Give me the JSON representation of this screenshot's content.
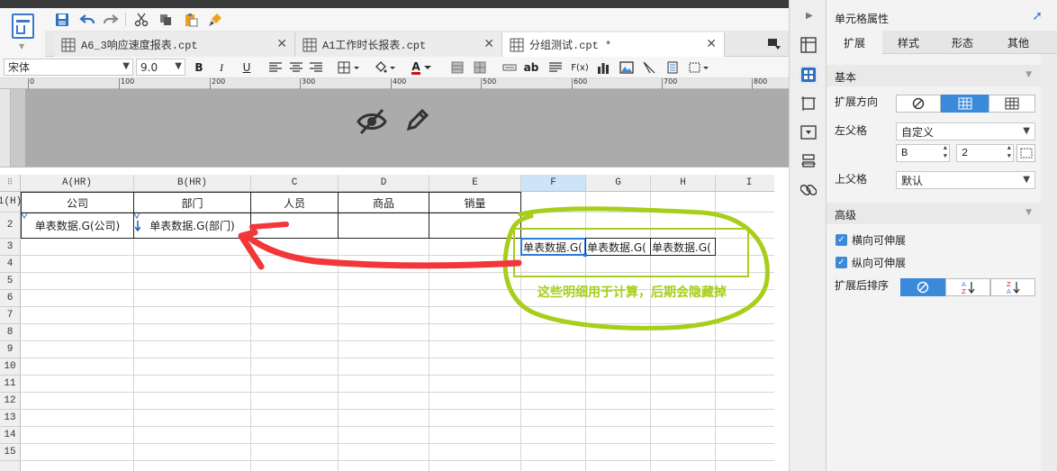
{
  "tabs": [
    {
      "label": "A6_3响应速度报表.cpt",
      "active": false
    },
    {
      "label": "A1工作时长报表.cpt",
      "active": false
    },
    {
      "label": "分组测试.cpt *",
      "active": true
    }
  ],
  "format_toolbar": {
    "font_name": "宋体",
    "font_size": "9.0",
    "bold": "B",
    "italic": "I",
    "underline": "U",
    "text_color_letter": "A",
    "ab_label": "ab",
    "fx_label": "F(x)"
  },
  "ruler_labels": [
    "0",
    "100",
    "200",
    "300",
    "400",
    "500",
    "600",
    "700",
    "800"
  ],
  "grid": {
    "corner_glyph": "⠿",
    "columns": [
      "A(HR)",
      "B(HR)",
      "C",
      "D",
      "E",
      "F",
      "G",
      "H",
      "I"
    ],
    "rows": [
      "1(H)",
      "2",
      "3",
      "4",
      "5",
      "6",
      "7",
      "8",
      "9",
      "10",
      "11",
      "12",
      "13",
      "14",
      "15"
    ],
    "selected_column": "F",
    "header_row": [
      "公司",
      "部门",
      "人员",
      "商品",
      "销量"
    ],
    "row2": [
      "单表数据.G(公司)",
      "单表数据.G(部门)"
    ],
    "row3": [
      "单表数据.G(",
      "单表数据.G(",
      "单表数据.G("
    ]
  },
  "annotation": {
    "note": "这些明细用于计算，后期会隐藏掉",
    "red": "#f2363a",
    "green": "#a6ce1a"
  },
  "panel": {
    "title": "单元格属性",
    "tabs": [
      "扩展",
      "样式",
      "形态",
      "其他"
    ],
    "active_tab": "扩展",
    "basic_title": "基本",
    "expand_direction_label": "扩展方向",
    "left_parent_label": "左父格",
    "left_parent_value": "自定义",
    "left_parent_col": "B",
    "left_parent_row": "2",
    "top_parent_label": "上父格",
    "top_parent_value": "默认",
    "advanced_title": "高级",
    "h_expand_label": "横向可伸展",
    "v_expand_label": "纵向可伸展",
    "sort_label": "扩展后排序"
  },
  "colors": {
    "accent": "#3b8ad9",
    "selected_col_header": "#cde3f7"
  }
}
